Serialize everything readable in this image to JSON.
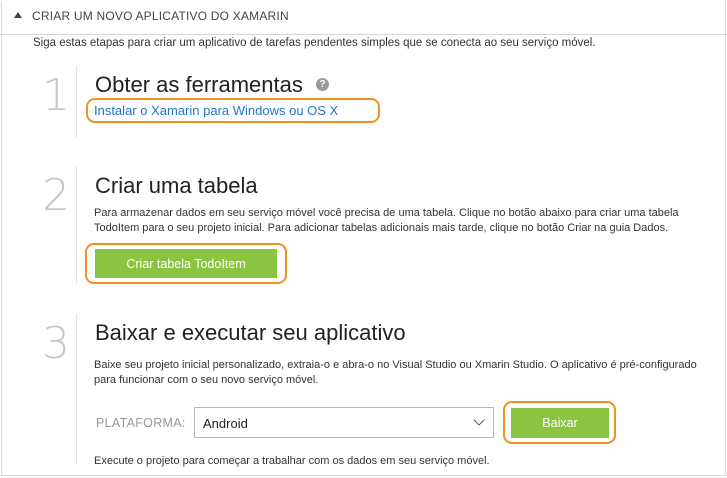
{
  "section": {
    "title": "CRIAR UM NOVO APLICATIVO DO XAMARIN"
  },
  "intro": "Siga estas etapas para criar um aplicativo de tarefas pendentes simples que se conecta ao seu serviço móvel.",
  "steps": [
    {
      "number": "1",
      "title": "Obter as ferramentas",
      "link": "Instalar o Xamarin para Windows ou OS X"
    },
    {
      "number": "2",
      "title": "Criar uma tabela",
      "description": "Para armazenar dados em seu serviço móvel você precisa de uma tabela. Clique no botão abaixo para criar uma tabela TodoItem para o seu projeto inicial. Para adicionar tabelas adicionais mais tarde, clique no botão Criar na guia Dados.",
      "button": "Criar tabela TodoItem"
    },
    {
      "number": "3",
      "title": "Baixar e executar seu aplicativo",
      "description": "Baixe seu projeto inicial personalizado, extraia-o e abra-o no Visual Studio ou Xmarin Studio. O aplicativo é pré-configurado para funcionar com o seu novo serviço móvel.",
      "platform_label": "PLATAFORMA:",
      "platform_value": "Android",
      "button": "Baixar",
      "footer": "Execute o projeto para começar a trabalhar com os dados em seu serviço móvel."
    }
  ],
  "colors": {
    "accent_green": "#8bc441",
    "highlight_orange": "#f0901e",
    "link_blue": "#1f75c8"
  },
  "icons": {
    "help": "question-circle-icon",
    "collapse": "caret-up-icon",
    "dropdown": "chevron-down-icon"
  }
}
